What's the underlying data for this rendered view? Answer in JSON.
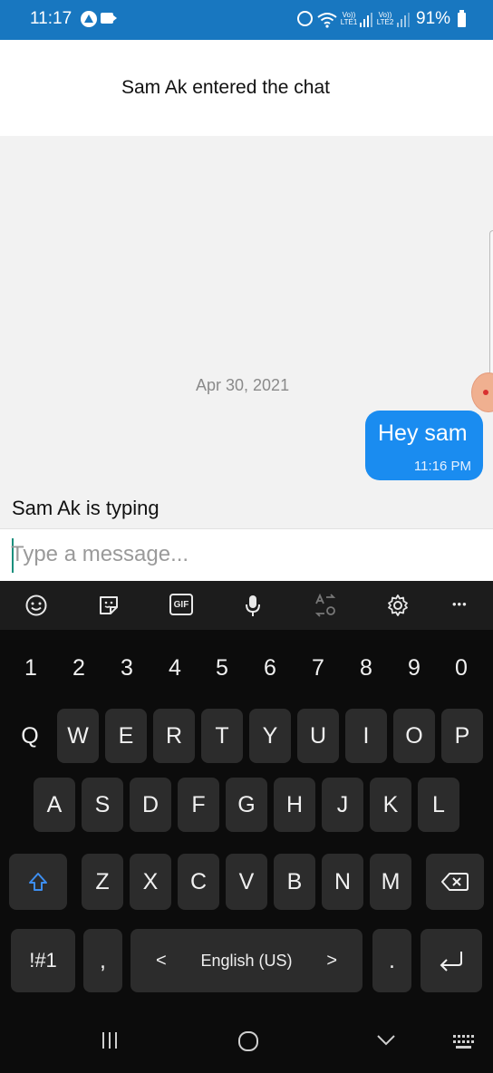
{
  "status_bar": {
    "time": "11:17",
    "lte1_label": "Vo))\nLTE1",
    "lte2_label": "Vo))\nLTE2",
    "battery": "91%"
  },
  "header": {
    "title": "Sam Ak entered the chat"
  },
  "chat": {
    "date_separator": "Apr 30, 2021",
    "messages": [
      {
        "text": "Hey sam",
        "time": "11:16 PM",
        "outgoing": true
      }
    ],
    "typing_indicator": "Sam Ak is typing"
  },
  "input": {
    "placeholder": "Type a message..."
  },
  "keyboard": {
    "toolbar": [
      "emoji-icon",
      "sticker-icon",
      "gif-icon",
      "mic-icon",
      "translate-icon",
      "settings-icon",
      "more-icon"
    ],
    "gif_label": "GIF",
    "number_row": [
      "1",
      "2",
      "3",
      "4",
      "5",
      "6",
      "7",
      "8",
      "9",
      "0"
    ],
    "row1": [
      "Q",
      "W",
      "E",
      "R",
      "T",
      "Y",
      "U",
      "I",
      "O",
      "P"
    ],
    "row2": [
      "A",
      "S",
      "D",
      "F",
      "G",
      "H",
      "J",
      "K",
      "L"
    ],
    "row3": [
      "Z",
      "X",
      "C",
      "V",
      "B",
      "N",
      "M"
    ],
    "symbols_key": "!#1",
    "comma_key": ",",
    "space_label": "English (US)",
    "space_left_arrow": "<",
    "space_right_arrow": ">",
    "period_key": ".",
    "more_label": "•••"
  },
  "colors": {
    "status_bar": "#1877c0",
    "bubble": "#1a8cf0",
    "keyboard_bg": "#0c0c0c",
    "key_bg": "#2c2c2c"
  }
}
